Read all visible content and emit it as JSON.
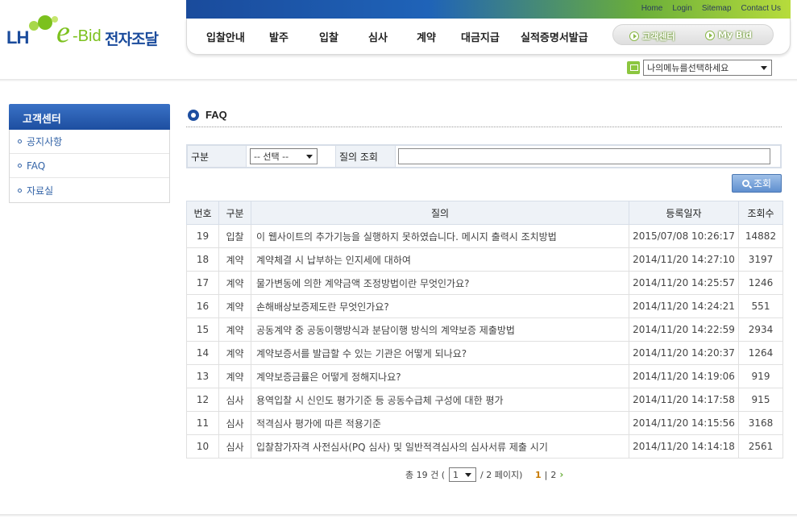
{
  "header": {
    "logo_lh": "LH",
    "logo_e": "e",
    "logo_bid": "-Bid",
    "logo_kor": "전자조달",
    "util_links": [
      "Home",
      "Login",
      "Sitemap",
      "Contact Us"
    ],
    "gnb": [
      "입찰안내",
      "발주",
      "입찰",
      "심사",
      "계약",
      "대금지급",
      "실적증명서발급"
    ],
    "pill_buttons": [
      "고객센터",
      "My Bid"
    ],
    "my_menu_select": "나의메뉴를선택하세요"
  },
  "sidebar": {
    "title": "고객센터",
    "items": [
      "공지사항",
      "FAQ",
      "자료실"
    ]
  },
  "page": {
    "title": "FAQ"
  },
  "search": {
    "category_label": "구분",
    "category_value": "-- 선택 --",
    "query_label": "질의 조회",
    "query_value": "",
    "button_label": "조회"
  },
  "table": {
    "headers": [
      "번호",
      "구분",
      "질의",
      "등록일자",
      "조회수"
    ],
    "rows": [
      [
        "19",
        "입찰",
        "이 웹사이트의 추가기능을 실행하지 못하였습니다. 메시지 출력시 조치방법",
        "2015/07/08 10:26:17",
        "14882"
      ],
      [
        "18",
        "계약",
        "계약체결 시 납부하는 인지세에 대하여",
        "2014/11/20 14:27:10",
        "3197"
      ],
      [
        "17",
        "계약",
        "물가변동에 의한 계약금액 조정방법이란 무엇인가요?",
        "2014/11/20 14:25:57",
        "1246"
      ],
      [
        "16",
        "계약",
        "손해배상보증제도란 무엇인가요?",
        "2014/11/20 14:24:21",
        "551"
      ],
      [
        "15",
        "계약",
        "공동계약 중 공동이행방식과 분담이행 방식의 계약보증 제출방법",
        "2014/11/20 14:22:59",
        "2934"
      ],
      [
        "14",
        "계약",
        "계약보증서를 발급할 수 있는 기관은 어떻게 되나요?",
        "2014/11/20 14:20:37",
        "1264"
      ],
      [
        "13",
        "계약",
        "계약보증금률은 어떻게 정해지나요?",
        "2014/11/20 14:19:06",
        "919"
      ],
      [
        "12",
        "심사",
        "용역입찰 시 신인도 평가기준 등 공동수급체 구성에 대한 평가",
        "2014/11/20 14:17:58",
        "915"
      ],
      [
        "11",
        "심사",
        "적격심사 평가에 따른 적용기준",
        "2014/11/20 14:15:56",
        "3168"
      ],
      [
        "10",
        "심사",
        "입찰참가자격 사전심사(PQ 심사) 및 일반적격심사의 심사서류 제출 시기",
        "2014/11/20 14:14:18",
        "2561"
      ]
    ]
  },
  "paging": {
    "total_prefix": "총 19 건 (",
    "page_select": "1",
    "total_suffix": "/ 2 페이지)",
    "current_page": "1",
    "separator": "|",
    "other_page": "2",
    "next": "›"
  },
  "colors": {
    "brand_blue": "#1a4b9c",
    "brand_green": "#7cc11e",
    "link_blue": "#3565a8",
    "current_page": "#c77a00"
  }
}
